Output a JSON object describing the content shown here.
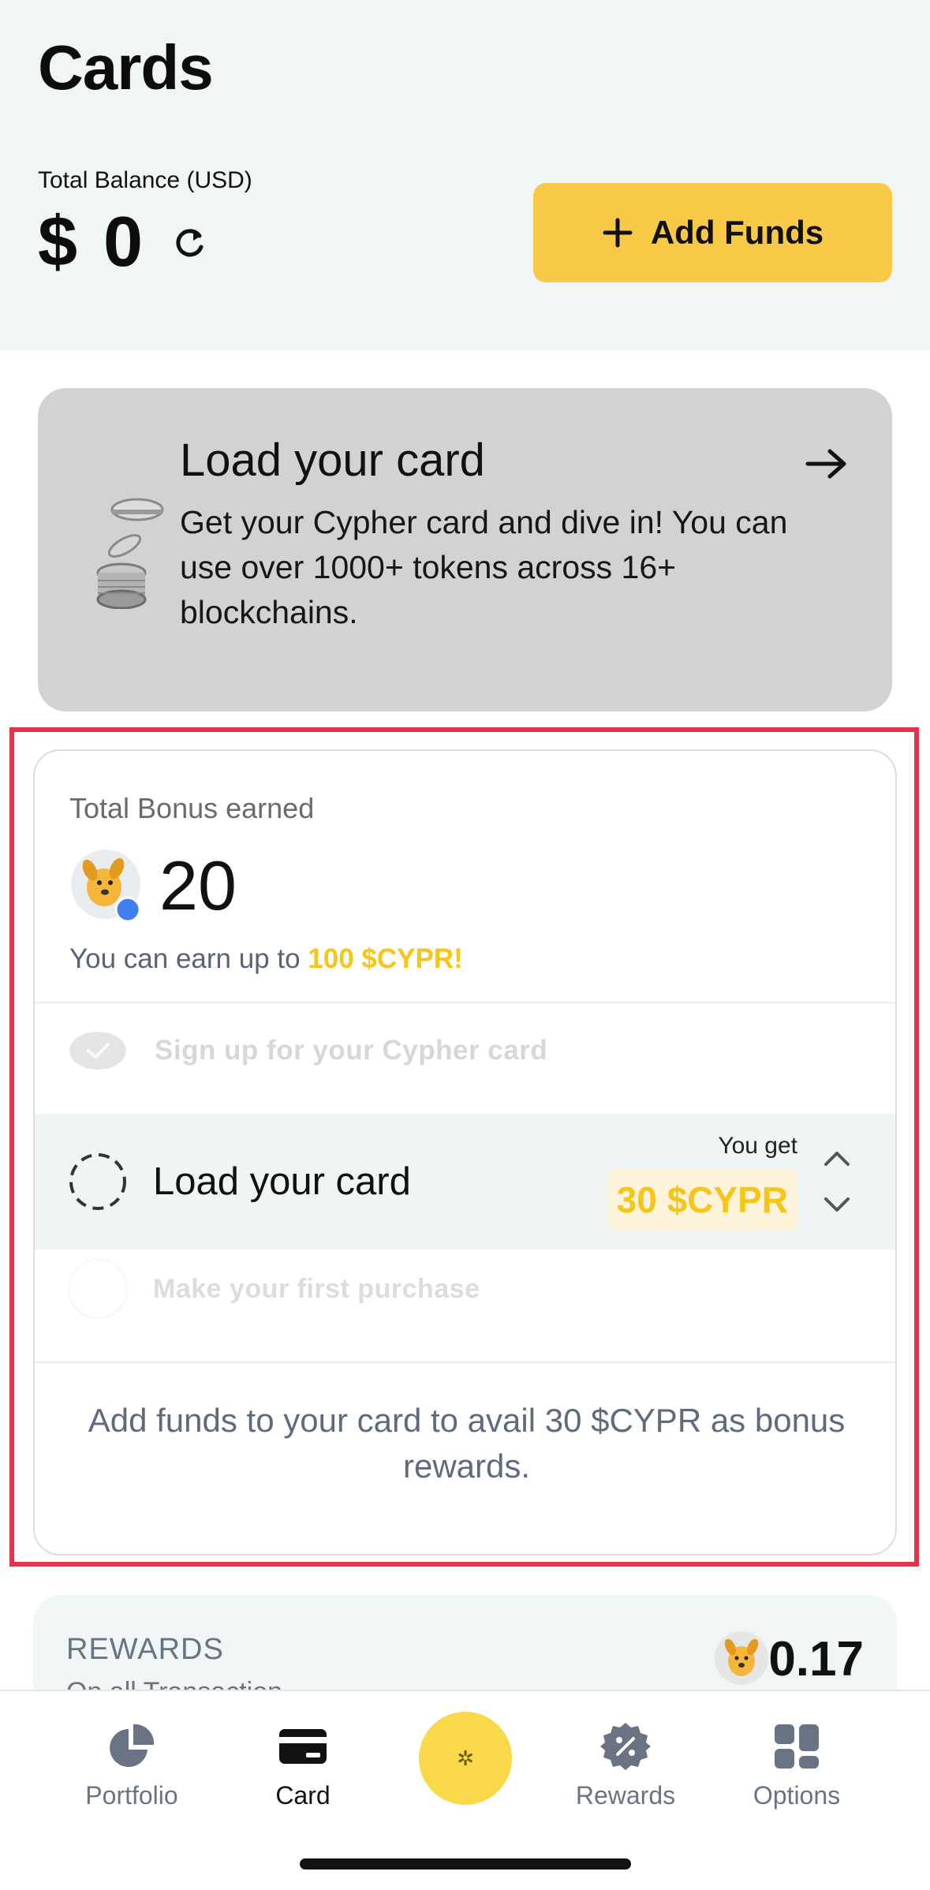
{
  "header": {
    "title": "Cards",
    "balance_label": "Total Balance (USD)",
    "balance_value": "$ 0",
    "add_funds_label": "Add Funds"
  },
  "load_banner": {
    "title": "Load your card",
    "description": "Get your Cypher card and dive in! You can use over 1000+ tokens across 16+ blockchains."
  },
  "bonus": {
    "label": "Total Bonus earned",
    "value": "20",
    "earn_prefix": "You can earn up to ",
    "earn_highlight": "100 $CYPR!",
    "steps": [
      {
        "label": "Sign up for your Cypher card",
        "state": "completed"
      },
      {
        "label": "Load your card",
        "state": "active",
        "you_get_label": "You get",
        "reward": "30 $CYPR"
      },
      {
        "label": "Make your first purchase",
        "state": "pending"
      }
    ],
    "footer": "Add funds to your card to avail 30 $CYPR as bonus rewards."
  },
  "rewards": {
    "title": "REWARDS",
    "subtitle": "On all Transaction",
    "value": "0.17"
  },
  "tab_bar": {
    "tabs": [
      {
        "label": "Portfolio",
        "icon": "pie-chart-icon",
        "active": false
      },
      {
        "label": "Card",
        "icon": "credit-card-icon",
        "active": true
      },
      {
        "label": "Rewards",
        "icon": "percent-badge-icon",
        "active": false
      },
      {
        "label": "Options",
        "icon": "grid-icon",
        "active": false
      }
    ],
    "center_action_icon": "sparkle-icon"
  },
  "colors": {
    "accent_yellow": "#f8c947",
    "reward_yellow": "#f5c518",
    "header_bg": "#f0f5f5",
    "highlight_red": "#e63347"
  }
}
